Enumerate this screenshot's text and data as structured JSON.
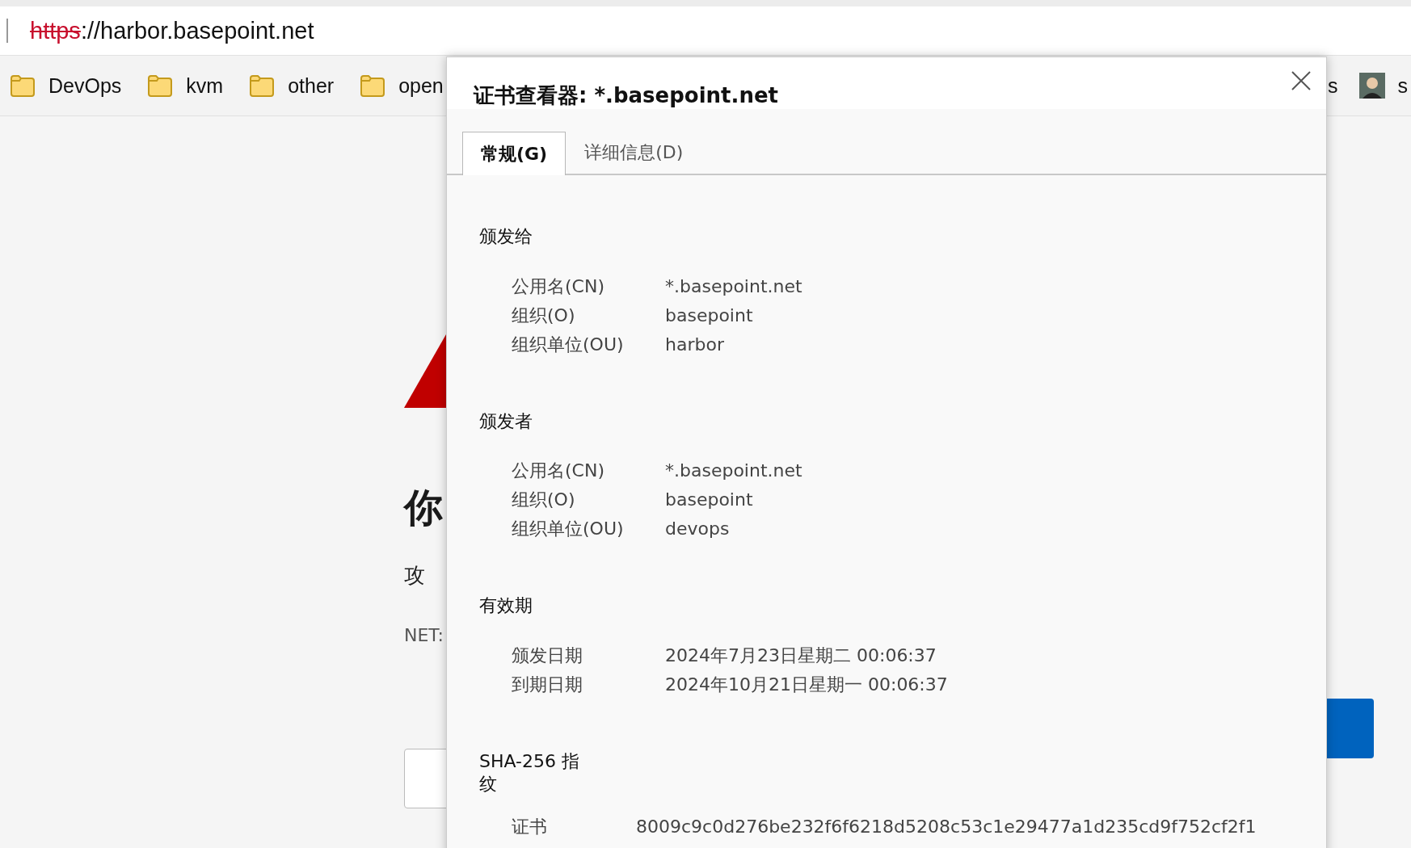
{
  "address_bar": {
    "scheme": "https",
    "rest": "://harbor.basepoint.net",
    "not_secure": true
  },
  "bookmarks": [
    {
      "label": "DevOps",
      "kind": "folder"
    },
    {
      "label": "kvm",
      "kind": "folder"
    },
    {
      "label": "other",
      "kind": "folder"
    },
    {
      "label": "open",
      "kind": "folder"
    },
    {
      "label": "s",
      "kind": "text"
    },
    {
      "label": "s",
      "kind": "avatar"
    }
  ],
  "page": {
    "heading": "你",
    "text": "攻",
    "code": "NET:",
    "buttons": [
      {
        "kind": "secondary"
      },
      {
        "kind": "primary"
      }
    ]
  },
  "dialog": {
    "title": "证书查看器: *.basepoint.net",
    "tabs": [
      {
        "label": "常规(G)",
        "selected": true
      },
      {
        "label": "详细信息(D)",
        "selected": false
      }
    ],
    "sections": [
      {
        "heading": "颁发给",
        "kind": "fields",
        "rows": [
          {
            "label": "公用名(CN)",
            "value": "*.basepoint.net"
          },
          {
            "label": "组织(O)",
            "value": "basepoint"
          },
          {
            "label": "组织单位(OU)",
            "value": "harbor"
          }
        ]
      },
      {
        "heading": "颁发者",
        "kind": "fields",
        "rows": [
          {
            "label": "公用名(CN)",
            "value": "*.basepoint.net"
          },
          {
            "label": "组织(O)",
            "value": "basepoint"
          },
          {
            "label": "组织单位(OU)",
            "value": "devops"
          }
        ]
      },
      {
        "heading": "有效期",
        "kind": "fields",
        "rows": [
          {
            "label": "颁发日期",
            "value": "2024年7月23日星期二 00:06:37"
          },
          {
            "label": "到期日期",
            "value": "2024年10月21日星期一 00:06:37"
          }
        ]
      },
      {
        "heading": "SHA-256 指纹",
        "kind": "fingerprint",
        "rows": [
          {
            "label": "证书",
            "value": "8009c9c0d276be232f6f6218d5208c53c1e29477a1d235cd9f752cf2f1"
          }
        ]
      }
    ]
  }
}
